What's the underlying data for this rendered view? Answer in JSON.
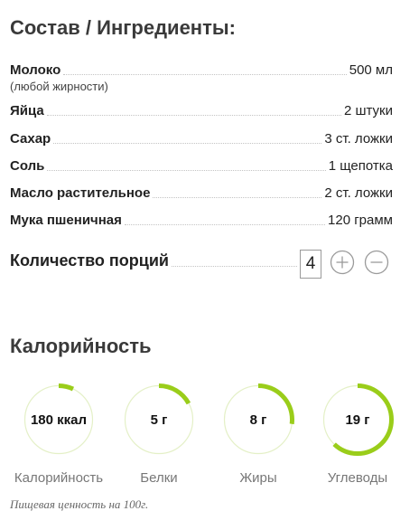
{
  "recipe": {
    "ingredients_title": "Состав / Ингредиенты:",
    "ingredients": [
      {
        "name": "Молоко",
        "amount": "500 мл",
        "note": "(любой жирности)"
      },
      {
        "name": "Яйца",
        "amount": "2 штуки"
      },
      {
        "name": "Сахар",
        "amount": "3 ст. ложки"
      },
      {
        "name": "Соль",
        "amount": "1 щепотка"
      },
      {
        "name": "Масло растительное",
        "amount": "2 ст. ложки"
      },
      {
        "name": "Мука пшеничная",
        "amount": "120 грамм"
      }
    ],
    "servings": {
      "label": "Количество порций",
      "value": "4"
    }
  },
  "nutrition": {
    "title": "Калорийность",
    "items": [
      {
        "value": "180 ккал",
        "label": "Калорийность",
        "fill": 0.07
      },
      {
        "value": "5 г",
        "label": "Белки",
        "fill": 0.17
      },
      {
        "value": "8 г",
        "label": "Жиры",
        "fill": 0.27
      },
      {
        "value": "19 г",
        "label": "Углеводы",
        "fill": 0.62
      }
    ],
    "footnote": "Пищевая ценность на 100г."
  },
  "colors": {
    "accent": "#9acd1a",
    "ring_track": "#e4f0c7"
  },
  "icons": {
    "increment": "plus-circle-icon",
    "decrement": "minus-circle-icon"
  }
}
